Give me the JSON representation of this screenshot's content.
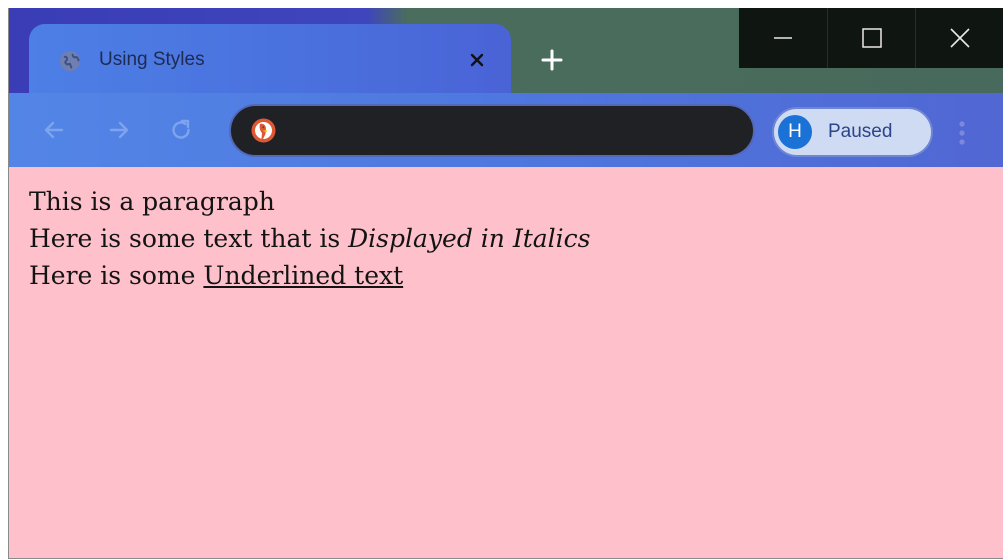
{
  "browser": {
    "tab": {
      "title": "Using Styles"
    },
    "address_bar": {
      "value": ""
    },
    "profile": {
      "initial": "H",
      "status": "Paused"
    }
  },
  "page": {
    "line1": "This is a paragraph",
    "line2_plain": "Here is some text that is ",
    "line2_italic": "Displayed in Italics",
    "line3_plain": "Here is some ",
    "line3_underlined": "Underlined text"
  },
  "colors": {
    "page_background": "#fec0ca",
    "toolbar": "#4e78df",
    "avatar": "#1a72d6"
  }
}
